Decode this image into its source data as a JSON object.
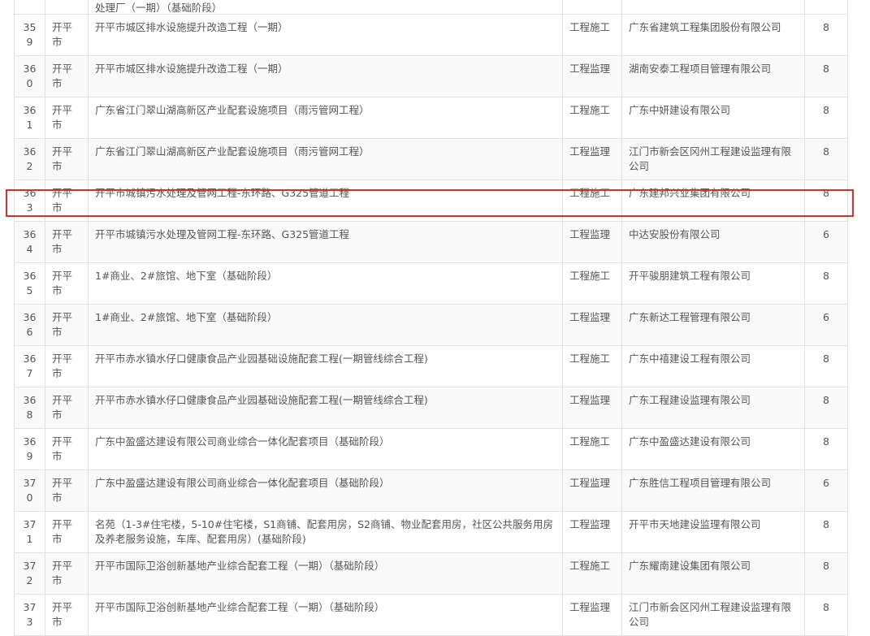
{
  "top_partial": {
    "name": "处理厂（一期）（基础阶段）"
  },
  "highlight_color": "#e52a2a",
  "rows": [
    {
      "no": "359",
      "city": "开平市",
      "name": "开平市城区排水设施提升改造工程（一期）",
      "type": "工程施工",
      "company": "广东省建筑工程集团股份有限公司",
      "score": "8"
    },
    {
      "no": "360",
      "city": "开平市",
      "name": "开平市城区排水设施提升改造工程（一期）",
      "type": "工程监理",
      "company": "湖南安泰工程项目管理有限公司",
      "score": "8"
    },
    {
      "no": "361",
      "city": "开平市",
      "name": "广东省江门翠山湖高新区产业配套设施项目（雨污管网工程）",
      "type": "工程施工",
      "company": "广东中妍建设有限公司",
      "score": "8"
    },
    {
      "no": "362",
      "city": "开平市",
      "name": "广东省江门翠山湖高新区产业配套设施项目（雨污管网工程）",
      "type": "工程监理",
      "company": "江门市新会区冈州工程建设监理有限公司",
      "score": "8"
    },
    {
      "no": "363",
      "city": "开平市",
      "name": "开平市城镇污水处理及管网工程-东环路、G325管道工程",
      "type": "工程施工",
      "company": "广东建邦兴业集团有限公司",
      "score": "8"
    },
    {
      "no": "364",
      "city": "开平市",
      "name": "开平市城镇污水处理及管网工程-东环路、G325管道工程",
      "type": "工程监理",
      "company": "中达安股份有限公司",
      "score": "6"
    },
    {
      "no": "365",
      "city": "开平市",
      "name": "1#商业、2#旅馆、地下室（基础阶段）",
      "type": "工程施工",
      "company": "开平骏朋建筑工程有限公司",
      "score": "8"
    },
    {
      "no": "366",
      "city": "开平市",
      "name": "1#商业、2#旅馆、地下室（基础阶段）",
      "type": "工程监理",
      "company": "广东新达工程管理有限公司",
      "score": "6"
    },
    {
      "no": "367",
      "city": "开平市",
      "name": "开平市赤水镇水仔口健康食品产业园基础设施配套工程(一期管线综合工程)",
      "type": "工程施工",
      "company": "广东中禧建设工程有限公司",
      "score": "8"
    },
    {
      "no": "368",
      "city": "开平市",
      "name": "开平市赤水镇水仔口健康食品产业园基础设施配套工程(一期管线综合工程)",
      "type": "工程监理",
      "company": "广东工程建设监理有限公司",
      "score": "8"
    },
    {
      "no": "369",
      "city": "开平市",
      "name": "广东中盈盛达建设有限公司商业综合一体化配套项目（基础阶段）",
      "type": "工程施工",
      "company": "广东中盈盛达建设有限公司",
      "score": "8"
    },
    {
      "no": "370",
      "city": "开平市",
      "name": "广东中盈盛达建设有限公司商业综合一体化配套项目（基础阶段）",
      "type": "工程监理",
      "company": "广东胜信工程项目管理有限公司",
      "score": "6"
    },
    {
      "no": "371",
      "city": "开平市",
      "name": "名苑（1-3#住宅楼，5-10#住宅楼，S1商铺、配套用房，S2商铺、物业配套用房，社区公共服务用房及养老服务设施，车库、配套用房）(基础阶段)",
      "type": "工程监理",
      "company": "开平市天地建设监理有限公司",
      "score": "8"
    },
    {
      "no": "372",
      "city": "开平市",
      "name": "开平市国际卫浴创新基地产业综合配套工程（一期）（基础阶段）",
      "type": "工程施工",
      "company": "广东耀南建设集团有限公司",
      "score": "8"
    },
    {
      "no": "373",
      "city": "开平市",
      "name": "开平市国际卫浴创新基地产业综合配套工程（一期）（基础阶段）",
      "type": "工程监理",
      "company": "江门市新会区冈州工程建设监理有限公司",
      "score": "8"
    }
  ]
}
